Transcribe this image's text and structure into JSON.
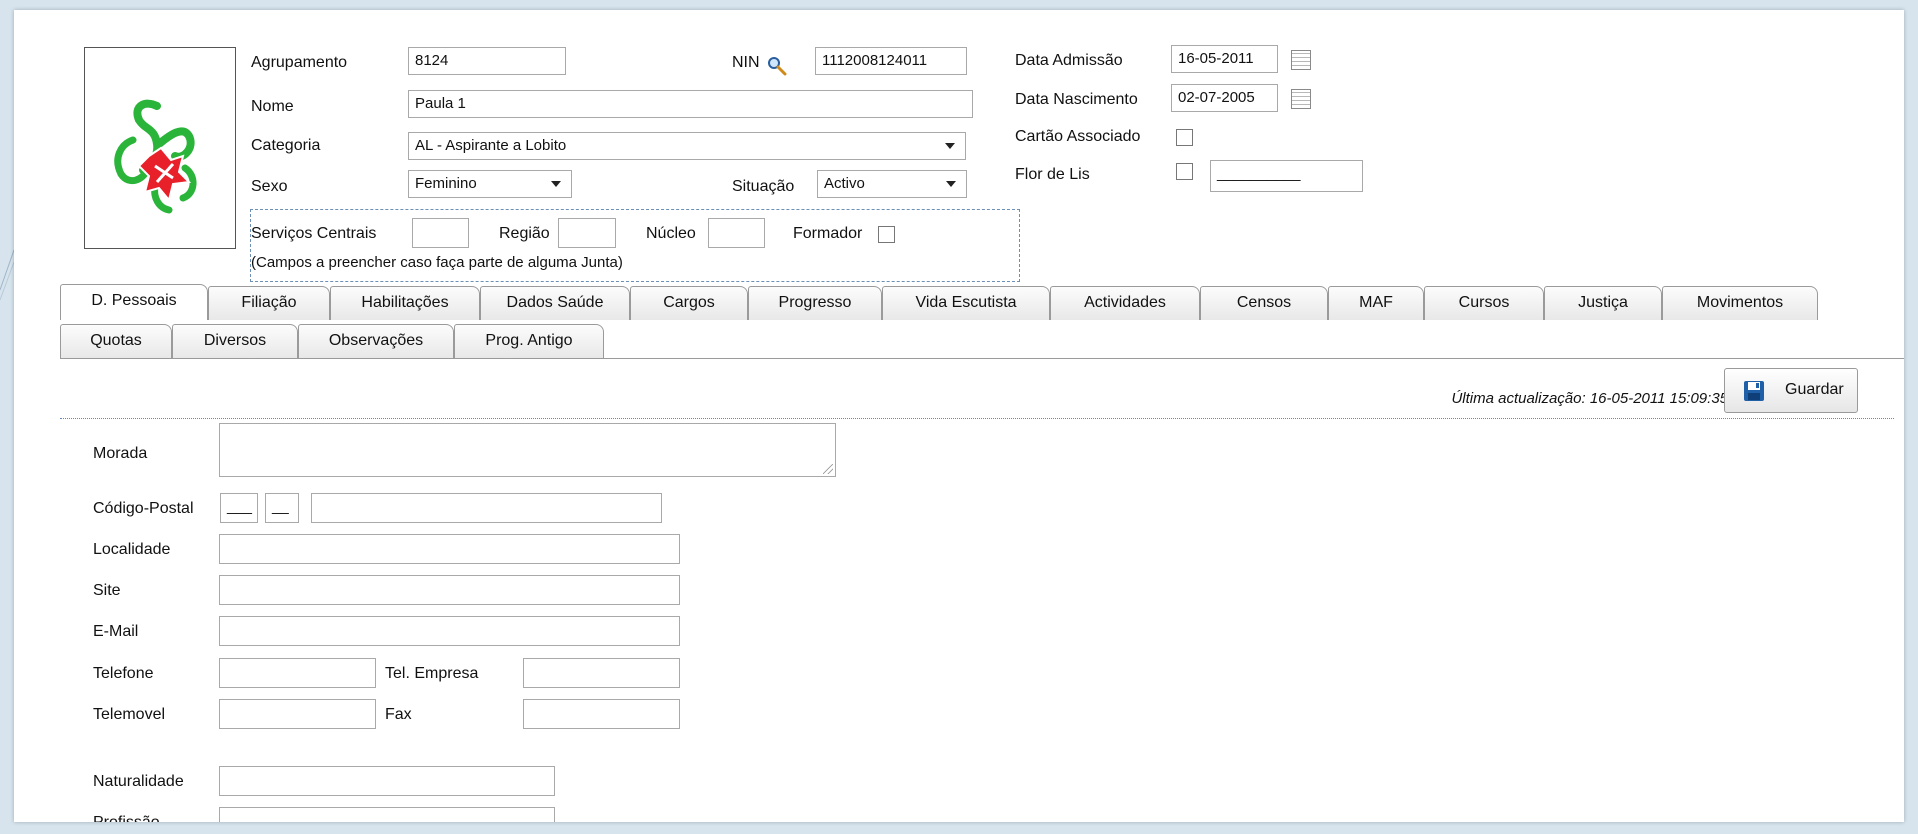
{
  "header": {
    "agrupamento_label": "Agrupamento",
    "agrupamento_value": "8124",
    "nin_label": "NIN",
    "nin_value": "1112008124011",
    "nome_label": "Nome",
    "nome_value": "Paula 1",
    "categoria_label": "Categoria",
    "categoria_value": "AL - Aspirante a Lobito",
    "sexo_label": "Sexo",
    "sexo_value": "Feminino",
    "situacao_label": "Situação",
    "situacao_value": "Activo",
    "data_admissao_label": "Data Admissão",
    "data_admissao_value": "16-05-2011",
    "data_nascimento_label": "Data Nascimento",
    "data_nascimento_value": "02-07-2005",
    "cartao_label": "Cartão Associado",
    "flor_label": "Flor de Lis",
    "flor_value": "__________"
  },
  "services": {
    "servicos_label": "Serviços Centrais",
    "regiao_label": "Região",
    "nucleo_label": "Núcleo",
    "formador_label": "Formador",
    "note": "(Campos a preencher caso faça parte de alguma Junta)"
  },
  "tabs_row1": [
    "D. Pessoais",
    "Filiação",
    "Habilitações",
    "Dados Saúde",
    "Cargos",
    "Progresso",
    "Vida Escutista",
    "Actividades",
    "Censos",
    "MAF",
    "Cursos",
    "Justiça",
    "Movimentos"
  ],
  "tabs_row2": [
    "Quotas",
    "Diversos",
    "Observações",
    "Prog. Antigo"
  ],
  "status": {
    "last_update": "Última actualização: 16-05-2011 15:09:35",
    "save_label": "Guardar"
  },
  "form": {
    "morada_label": "Morada",
    "codigo_postal_label": "Código-Postal",
    "cp1_value": "___",
    "cp2_value": "__",
    "localidade_label": "Localidade",
    "site_label": "Site",
    "email_label": "E-Mail",
    "telefone_label": "Telefone",
    "tel_empresa_label": "Tel. Empresa",
    "telemovel_label": "Telemovel",
    "fax_label": "Fax",
    "naturalidade_label": "Naturalidade",
    "profissao_label": "Profissão"
  },
  "icons": {
    "logo": "fleur-de-lis-logo",
    "nin_search": "magnifier-icon",
    "calendar": "calendar-icon",
    "save": "floppy-disk-icon"
  },
  "colors": {
    "logo_green": "#2bb43a",
    "logo_red": "#e8202a",
    "accent_dotted": "#5d8bbd",
    "save_icon": "#1f5fa8"
  }
}
